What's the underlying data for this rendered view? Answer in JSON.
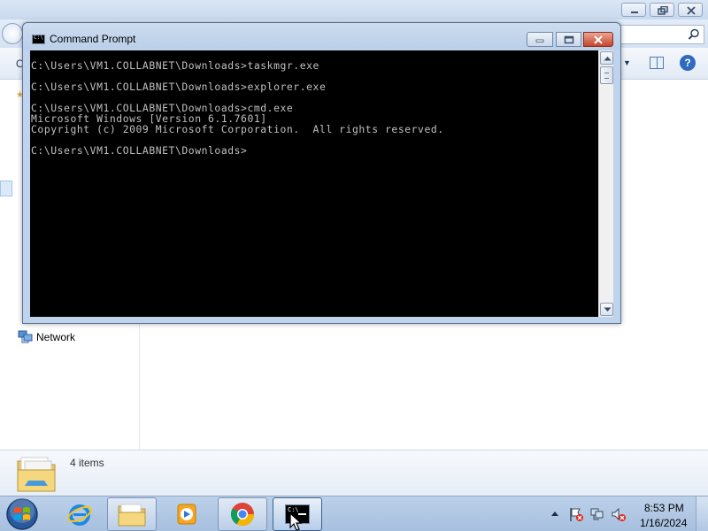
{
  "cmd_window": {
    "title": "Command Prompt",
    "icon_text": "C:\\",
    "console_lines": [
      "C:\\Users\\VM1.COLLABNET\\Downloads>taskmgr.exe",
      "",
      "C:\\Users\\VM1.COLLABNET\\Downloads>explorer.exe",
      "",
      "C:\\Users\\VM1.COLLABNET\\Downloads>cmd.exe",
      "Microsoft Windows [Version 6.1.7601]",
      "Copyright (c) 2009 Microsoft Corporation.  All rights reserved.",
      "",
      "C:\\Users\\VM1.COLLABNET\\Downloads>"
    ]
  },
  "explorer": {
    "toolbar_partial_label": "O",
    "nav": {
      "network_label": "Network"
    },
    "details": {
      "item_count": "4 items"
    }
  },
  "taskbar": {
    "apps": [
      "start-orb",
      "internet-explorer",
      "windows-explorer",
      "windows-media-player",
      "google-chrome",
      "command-prompt"
    ],
    "tb_cmd_icon_text": "C:\\",
    "clock": {
      "time": "8:53 PM",
      "date": "1/16/2024"
    }
  },
  "colors": {
    "titlebar": "#bfd4ec",
    "console_bg": "#000000",
    "console_text": "#c0c0c0",
    "taskbar": "#b4cae6",
    "close_button": "#c7442b"
  }
}
